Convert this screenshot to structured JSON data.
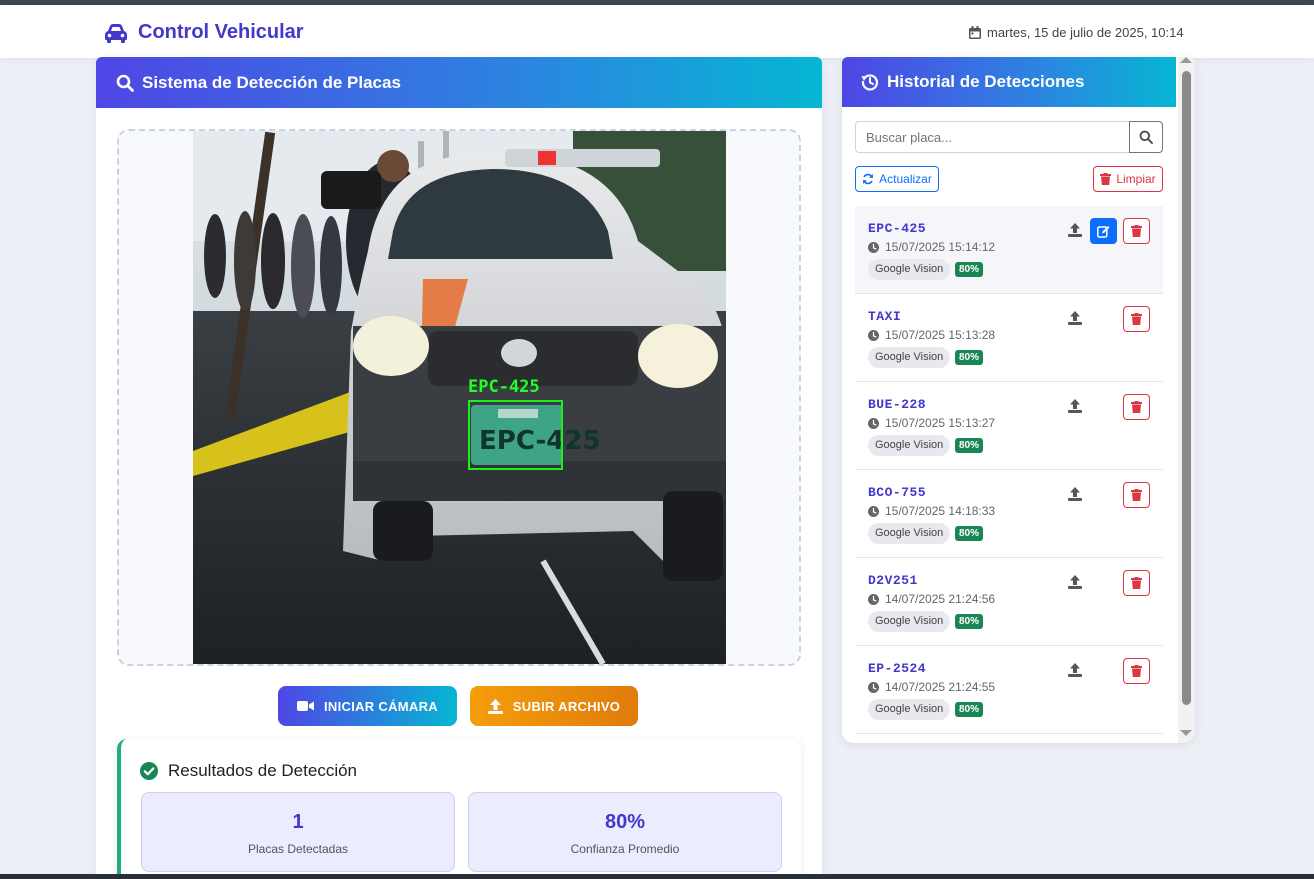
{
  "navbar": {
    "brand": "Control Vehicular",
    "datetime": "martes, 15 de julio de 2025, 10:14",
    "brand_icon": "car-icon",
    "date_icon": "calendar-icon"
  },
  "detection": {
    "title": "Sistema de Detección de Placas",
    "title_icon": "search-icon",
    "overlay_label": "EPC-425",
    "buttons": {
      "camera": "INICIAR CÁMARA",
      "upload": "SUBIR ARCHIVO"
    },
    "results": {
      "title": "Resultados de Detección",
      "plates_value": "1",
      "plates_label": "Placas Detectadas",
      "confidence_value": "80%",
      "confidence_label": "Confianza Promedio"
    }
  },
  "history": {
    "title": "Historial de Detecciones",
    "title_icon": "history-icon",
    "search_placeholder": "Buscar placa...",
    "refresh_label": "Actualizar",
    "clear_label": "Limpiar",
    "items": [
      {
        "plate": "EPC-425",
        "time": "15/07/2025 15:14:12",
        "source": "Google Vision",
        "confidence": "80%"
      },
      {
        "plate": "TAXI",
        "time": "15/07/2025 15:13:28",
        "source": "Google Vision",
        "confidence": "80%"
      },
      {
        "plate": "BUE-228",
        "time": "15/07/2025 15:13:27",
        "source": "Google Vision",
        "confidence": "80%"
      },
      {
        "plate": "BCO-755",
        "time": "15/07/2025 14:18:33",
        "source": "Google Vision",
        "confidence": "80%"
      },
      {
        "plate": "D2V251",
        "time": "14/07/2025 21:24:56",
        "source": "Google Vision",
        "confidence": "80%"
      },
      {
        "plate": "EP-2524",
        "time": "14/07/2025 21:24:55",
        "source": "Google Vision",
        "confidence": "80%"
      }
    ]
  },
  "colors": {
    "brand": "#4338ca",
    "success": "#198754",
    "danger": "#dc3545",
    "primary": "#0d6efd",
    "upload": "#f59e0b"
  }
}
